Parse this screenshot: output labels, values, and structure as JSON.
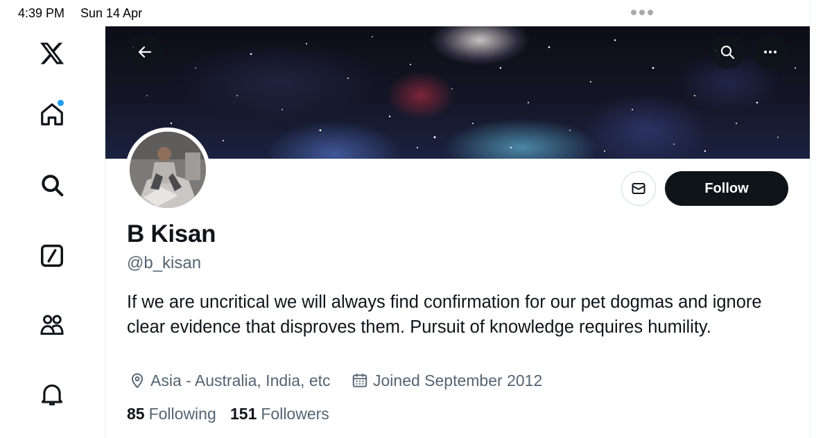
{
  "status_bar": {
    "time": "4:39 PM",
    "date": "Sun 14 Apr"
  },
  "sidebar": {
    "items": [
      {
        "icon": "x-logo-icon"
      },
      {
        "icon": "home-icon",
        "notification_dot": true
      },
      {
        "icon": "search-icon"
      },
      {
        "icon": "grok-icon"
      },
      {
        "icon": "communities-icon"
      },
      {
        "icon": "notifications-bell-icon"
      }
    ]
  },
  "header": {
    "back_icon": "arrow-left-icon",
    "search_icon": "search-icon",
    "more_icon": "more-dots-icon"
  },
  "profile": {
    "name": "B Kisan",
    "handle": "@b_kisan",
    "bio": "If we are uncritical we will always find confirmation for our pet dogmas and ignore clear evidence that disproves them. Pursuit of knowledge requires humility.",
    "location": "Asia - Australia, India, etc",
    "joined": "Joined September 2012",
    "following_count": "85",
    "following_label": "Following",
    "followers_count": "151",
    "followers_label": "Followers",
    "follow_button": "Follow",
    "message_icon": "envelope-icon"
  },
  "colors": {
    "accent": "#1d9bf0",
    "text_primary": "#0f1419",
    "text_secondary": "#536471",
    "button_dark": "#0f1419"
  }
}
